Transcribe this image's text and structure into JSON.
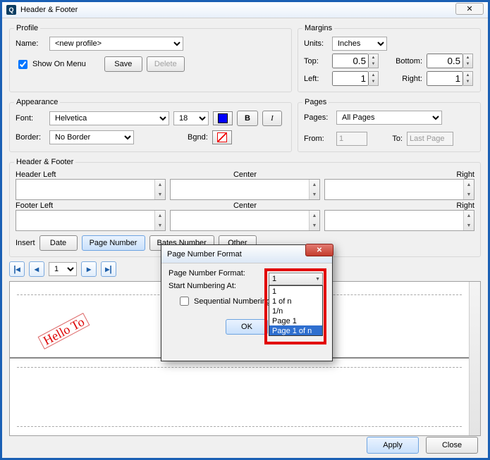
{
  "window": {
    "title": "Header & Footer",
    "close_glyph": "✕"
  },
  "profile": {
    "legend": "Profile",
    "name_label": "Name:",
    "name_value": "<new profile>",
    "show_on_menu": "Show On Menu",
    "save": "Save",
    "delete": "Delete"
  },
  "margins": {
    "legend": "Margins",
    "units_label": "Units:",
    "units_value": "Inches",
    "top_label": "Top:",
    "top_value": "0.5",
    "bottom_label": "Bottom:",
    "bottom_value": "0.5",
    "left_label": "Left:",
    "left_value": "1",
    "right_label": "Right:",
    "right_value": "1"
  },
  "appearance": {
    "legend": "Appearance",
    "font_label": "Font:",
    "font_value": "Helvetica",
    "size_value": "18",
    "bold": "B",
    "italic": "I",
    "border_label": "Border:",
    "border_value": "No Border",
    "bgnd_label": "Bgnd:"
  },
  "pages": {
    "legend": "Pages",
    "pages_label": "Pages:",
    "pages_value": "All Pages",
    "from_label": "From:",
    "from_value": "1",
    "to_label": "To:",
    "to_value": "Last Page"
  },
  "hf": {
    "legend": "Header & Footer",
    "header_left": "Header Left",
    "center": "Center",
    "right": "Right",
    "footer_left": "Footer Left"
  },
  "insert": {
    "label": "Insert",
    "date": "Date",
    "page_number": "Page Number",
    "bates": "Bates Number",
    "other": "Other"
  },
  "nav": {
    "page": "1"
  },
  "preview_text": "Hello To",
  "dialog": {
    "title": "Page Number Format",
    "fmt_label": "Page Number Format:",
    "fmt_value": "1",
    "start_label": "Start Numbering At:",
    "seq_label": "Sequential Numbering",
    "ok": "OK",
    "options": [
      "1",
      "1 of n",
      "1/n",
      "Page 1",
      "Page 1 of n"
    ],
    "highlighted": "Page 1 of n",
    "close_glyph": "✕"
  },
  "footer": {
    "apply": "Apply",
    "close": "Close"
  }
}
